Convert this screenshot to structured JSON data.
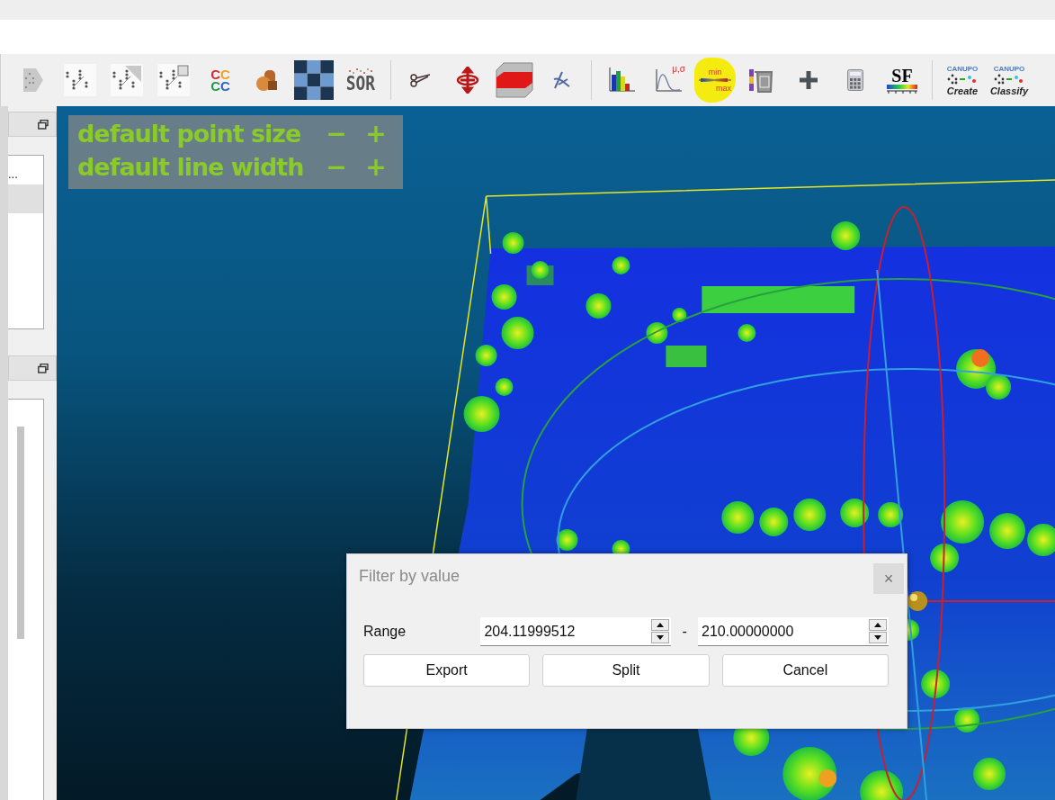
{
  "toolbar": {
    "groups": [
      {
        "items": [
          {
            "kind": "cone",
            "highlighted": false
          },
          {
            "kind": "scatter",
            "highlighted": false
          },
          {
            "kind": "scatter-shade",
            "highlighted": false
          },
          {
            "kind": "scatter-zoom",
            "highlighted": false
          },
          {
            "kind": "letters",
            "lines": [
              "CC",
              "CC"
            ],
            "highlighted": false
          },
          {
            "kind": "cylinders",
            "highlighted": false
          },
          {
            "kind": "checker",
            "highlighted": false
          },
          {
            "kind": "sor",
            "label": "SOR",
            "highlighted": false
          }
        ]
      },
      {
        "items": [
          {
            "kind": "scissors",
            "highlighted": false
          },
          {
            "kind": "move",
            "highlighted": false
          },
          {
            "kind": "box-slice",
            "highlighted": false
          },
          {
            "kind": "pin",
            "highlighted": false
          }
        ]
      },
      {
        "items": [
          {
            "kind": "histogram",
            "highlighted": false
          },
          {
            "kind": "curve",
            "label": "μ,σ",
            "highlighted": false
          },
          {
            "kind": "minmax",
            "lines": [
              "min",
              "max"
            ],
            "highlighted": true
          },
          {
            "kind": "trash",
            "highlighted": false
          },
          {
            "kind": "plus",
            "highlighted": false
          },
          {
            "kind": "calculator",
            "highlighted": false
          },
          {
            "kind": "sf",
            "label": "SF",
            "highlighted": false
          }
        ]
      },
      {
        "items": [
          {
            "kind": "canupo",
            "label": "CANUPO",
            "caption": "Create",
            "highlighted": false
          },
          {
            "kind": "canupo",
            "label": "CANUPO",
            "caption": "Classify",
            "highlighted": false
          }
        ]
      }
    ]
  },
  "left_dock": {
    "tree_item": "..."
  },
  "display_options": [
    {
      "label": "default point size",
      "minus": "−",
      "plus": "+"
    },
    {
      "label": "default line width",
      "minus": "−",
      "plus": "+"
    }
  ],
  "dialog": {
    "title": "Filter by value",
    "close": "×",
    "range_label": "Range",
    "from": "204.11999512",
    "separator": "-",
    "to": "210.00000000",
    "buttons": [
      "Export",
      "Split",
      "Cancel"
    ]
  }
}
